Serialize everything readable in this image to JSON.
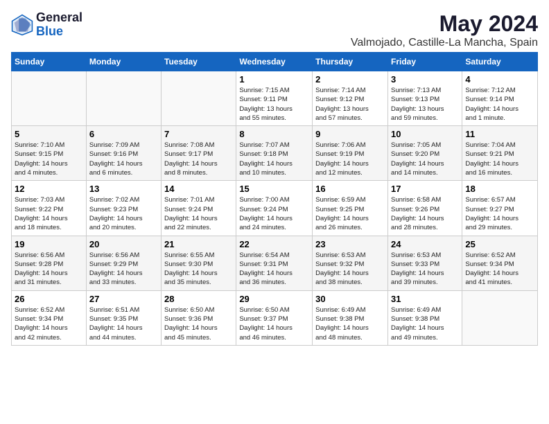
{
  "logo": {
    "general": "General",
    "blue": "Blue"
  },
  "title": {
    "month": "May 2024",
    "location": "Valmojado, Castille-La Mancha, Spain"
  },
  "days_of_week": [
    "Sunday",
    "Monday",
    "Tuesday",
    "Wednesday",
    "Thursday",
    "Friday",
    "Saturday"
  ],
  "weeks": [
    [
      {
        "day": "",
        "info": ""
      },
      {
        "day": "",
        "info": ""
      },
      {
        "day": "",
        "info": ""
      },
      {
        "day": "1",
        "info": "Sunrise: 7:15 AM\nSunset: 9:11 PM\nDaylight: 13 hours\nand 55 minutes."
      },
      {
        "day": "2",
        "info": "Sunrise: 7:14 AM\nSunset: 9:12 PM\nDaylight: 13 hours\nand 57 minutes."
      },
      {
        "day": "3",
        "info": "Sunrise: 7:13 AM\nSunset: 9:13 PM\nDaylight: 13 hours\nand 59 minutes."
      },
      {
        "day": "4",
        "info": "Sunrise: 7:12 AM\nSunset: 9:14 PM\nDaylight: 14 hours\nand 1 minute."
      }
    ],
    [
      {
        "day": "5",
        "info": "Sunrise: 7:10 AM\nSunset: 9:15 PM\nDaylight: 14 hours\nand 4 minutes."
      },
      {
        "day": "6",
        "info": "Sunrise: 7:09 AM\nSunset: 9:16 PM\nDaylight: 14 hours\nand 6 minutes."
      },
      {
        "day": "7",
        "info": "Sunrise: 7:08 AM\nSunset: 9:17 PM\nDaylight: 14 hours\nand 8 minutes."
      },
      {
        "day": "8",
        "info": "Sunrise: 7:07 AM\nSunset: 9:18 PM\nDaylight: 14 hours\nand 10 minutes."
      },
      {
        "day": "9",
        "info": "Sunrise: 7:06 AM\nSunset: 9:19 PM\nDaylight: 14 hours\nand 12 minutes."
      },
      {
        "day": "10",
        "info": "Sunrise: 7:05 AM\nSunset: 9:20 PM\nDaylight: 14 hours\nand 14 minutes."
      },
      {
        "day": "11",
        "info": "Sunrise: 7:04 AM\nSunset: 9:21 PM\nDaylight: 14 hours\nand 16 minutes."
      }
    ],
    [
      {
        "day": "12",
        "info": "Sunrise: 7:03 AM\nSunset: 9:22 PM\nDaylight: 14 hours\nand 18 minutes."
      },
      {
        "day": "13",
        "info": "Sunrise: 7:02 AM\nSunset: 9:23 PM\nDaylight: 14 hours\nand 20 minutes."
      },
      {
        "day": "14",
        "info": "Sunrise: 7:01 AM\nSunset: 9:24 PM\nDaylight: 14 hours\nand 22 minutes."
      },
      {
        "day": "15",
        "info": "Sunrise: 7:00 AM\nSunset: 9:24 PM\nDaylight: 14 hours\nand 24 minutes."
      },
      {
        "day": "16",
        "info": "Sunrise: 6:59 AM\nSunset: 9:25 PM\nDaylight: 14 hours\nand 26 minutes."
      },
      {
        "day": "17",
        "info": "Sunrise: 6:58 AM\nSunset: 9:26 PM\nDaylight: 14 hours\nand 28 minutes."
      },
      {
        "day": "18",
        "info": "Sunrise: 6:57 AM\nSunset: 9:27 PM\nDaylight: 14 hours\nand 29 minutes."
      }
    ],
    [
      {
        "day": "19",
        "info": "Sunrise: 6:56 AM\nSunset: 9:28 PM\nDaylight: 14 hours\nand 31 minutes."
      },
      {
        "day": "20",
        "info": "Sunrise: 6:56 AM\nSunset: 9:29 PM\nDaylight: 14 hours\nand 33 minutes."
      },
      {
        "day": "21",
        "info": "Sunrise: 6:55 AM\nSunset: 9:30 PM\nDaylight: 14 hours\nand 35 minutes."
      },
      {
        "day": "22",
        "info": "Sunrise: 6:54 AM\nSunset: 9:31 PM\nDaylight: 14 hours\nand 36 minutes."
      },
      {
        "day": "23",
        "info": "Sunrise: 6:53 AM\nSunset: 9:32 PM\nDaylight: 14 hours\nand 38 minutes."
      },
      {
        "day": "24",
        "info": "Sunrise: 6:53 AM\nSunset: 9:33 PM\nDaylight: 14 hours\nand 39 minutes."
      },
      {
        "day": "25",
        "info": "Sunrise: 6:52 AM\nSunset: 9:34 PM\nDaylight: 14 hours\nand 41 minutes."
      }
    ],
    [
      {
        "day": "26",
        "info": "Sunrise: 6:52 AM\nSunset: 9:34 PM\nDaylight: 14 hours\nand 42 minutes."
      },
      {
        "day": "27",
        "info": "Sunrise: 6:51 AM\nSunset: 9:35 PM\nDaylight: 14 hours\nand 44 minutes."
      },
      {
        "day": "28",
        "info": "Sunrise: 6:50 AM\nSunset: 9:36 PM\nDaylight: 14 hours\nand 45 minutes."
      },
      {
        "day": "29",
        "info": "Sunrise: 6:50 AM\nSunset: 9:37 PM\nDaylight: 14 hours\nand 46 minutes."
      },
      {
        "day": "30",
        "info": "Sunrise: 6:49 AM\nSunset: 9:38 PM\nDaylight: 14 hours\nand 48 minutes."
      },
      {
        "day": "31",
        "info": "Sunrise: 6:49 AM\nSunset: 9:38 PM\nDaylight: 14 hours\nand 49 minutes."
      },
      {
        "day": "",
        "info": ""
      }
    ]
  ]
}
